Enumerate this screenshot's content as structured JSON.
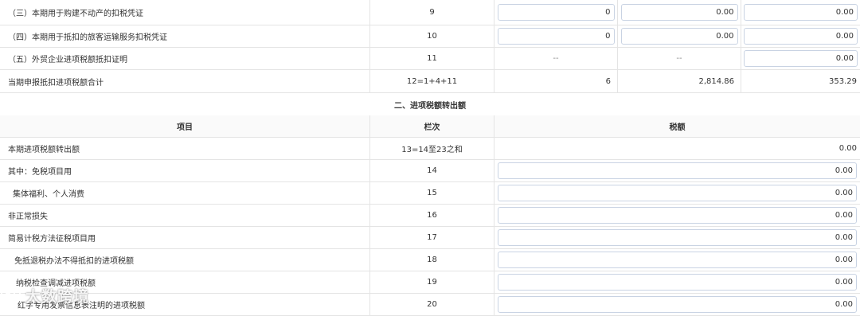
{
  "top_rows": [
    {
      "label": "（三）本期用于购建不动产的扣税凭证",
      "lanci": "9",
      "a": "0",
      "b": "0.00",
      "c": "0.00"
    },
    {
      "label": "（四）本期用于抵扣的旅客运输服务扣税凭证",
      "lanci": "10",
      "a": "0",
      "b": "0.00",
      "c": "0.00"
    },
    {
      "label": "（五）外贸企业进项税额抵扣证明",
      "lanci": "11",
      "a": "--",
      "b": "--",
      "c": "0.00"
    },
    {
      "label": "当期申报抵扣进项税额合计",
      "lanci": "12=1+4+11",
      "a": "6",
      "b": "2,814.86",
      "c": "353.29"
    }
  ],
  "section_title": "二、进项税额转出额",
  "header": {
    "item": "项目",
    "lanci": "栏次",
    "tax": "税额"
  },
  "rows": [
    {
      "label": "本期进项税额转出额",
      "lanci": "13=14至23之和",
      "tax": "0.00"
    },
    {
      "label": "其中：免税项目用",
      "lanci": "14",
      "tax": "0.00"
    },
    {
      "label": "集体福利、个人消费",
      "lanci": "15",
      "tax": "0.00"
    },
    {
      "label": "非正常损失",
      "lanci": "16",
      "tax": "0.00"
    },
    {
      "label": "简易计税方法征税项目用",
      "lanci": "17",
      "tax": "0.00"
    },
    {
      "label": "免抵退税办法不得抵扣的进项税额",
      "lanci": "18",
      "tax": "0.00"
    },
    {
      "label": "纳税检查调减进项税额",
      "lanci": "19",
      "tax": "0.00"
    },
    {
      "label": "红字专用发票信息表注明的进项税额",
      "lanci": "20",
      "tax": "0.00"
    }
  ],
  "watermark": {
    "text": "大数跨境",
    "icon": "logo-icon"
  }
}
